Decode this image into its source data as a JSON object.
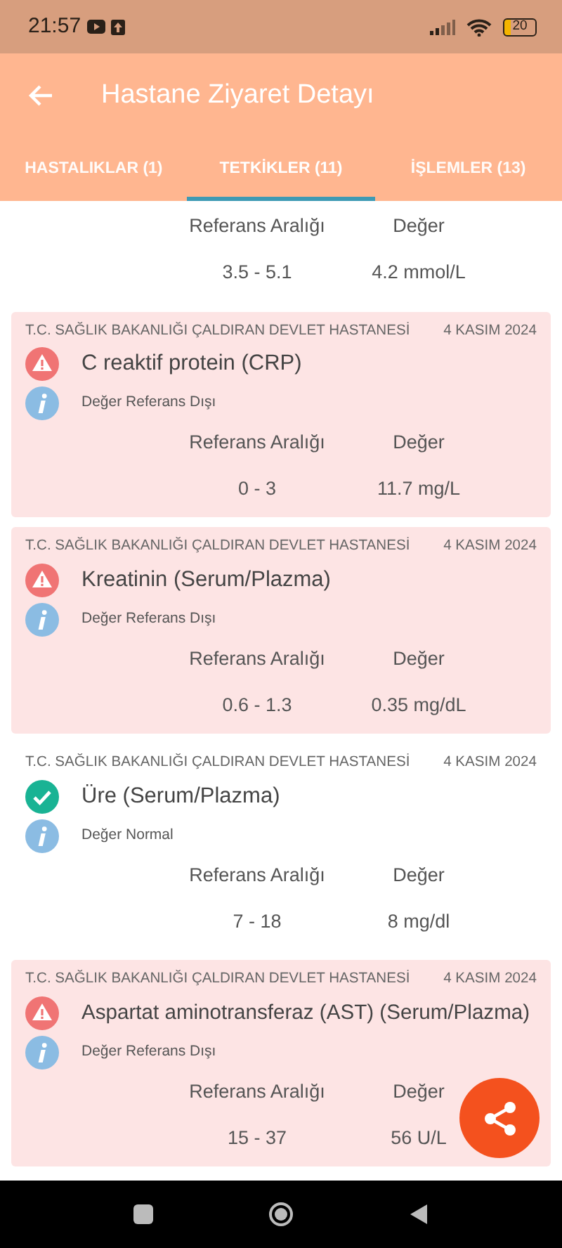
{
  "status_bar": {
    "time": "21:57",
    "battery": "20"
  },
  "app_bar": {
    "title": "Hastane Ziyaret Detayı"
  },
  "tabs": [
    {
      "label": "HASTALIKLAR (1)",
      "selected": false
    },
    {
      "label": "TETKİKLER (11)",
      "selected": true
    },
    {
      "label": "İŞLEMLER (13)",
      "selected": false
    }
  ],
  "tests": [
    {
      "range_label": "Referans Aralığı",
      "value_label": "Değer",
      "range": "3.5 - 5.1",
      "value": "4.2 mmol/L"
    },
    {
      "hospital": "T.C. SAĞLIK BAKANLIĞI ÇALDIRAN DEVLET HASTANESİ",
      "date": "4 KASIM 2024",
      "name": "C reaktif protein (CRP)",
      "kind": "abnormal",
      "note": "Değer Referans Dışı",
      "range_label": "Referans Aralığı",
      "value_label": "Değer",
      "range": "0 - 3",
      "value": "11.7 mg/L"
    },
    {
      "hospital": "T.C. SAĞLIK BAKANLIĞI ÇALDIRAN DEVLET HASTANESİ",
      "date": "4 KASIM 2024",
      "name": "Kreatinin (Serum/Plazma)",
      "kind": "abnormal",
      "note": "Değer Referans Dışı",
      "range_label": "Referans Aralığı",
      "value_label": "Değer",
      "range": "0.6 - 1.3",
      "value": "0.35 mg/dL"
    },
    {
      "hospital": "T.C. SAĞLIK BAKANLIĞI ÇALDIRAN DEVLET HASTANESİ",
      "date": "4 KASIM 2024",
      "name": "Üre (Serum/Plazma)",
      "kind": "normal",
      "note": "Değer Normal",
      "range_label": "Referans Aralığı",
      "value_label": "Değer",
      "range": "7 - 18",
      "value": "8 mg/dl"
    },
    {
      "hospital": "T.C. SAĞLIK BAKANLIĞI ÇALDIRAN DEVLET HASTANESİ",
      "date": "4 KASIM 2024",
      "name": "Aspartat aminotransferaz (AST) (Serum/Plazma)",
      "kind": "abnormal",
      "note": "Değer Referans Dışı",
      "range_label": "Referans Aralığı",
      "value_label": "Değer",
      "range": "15 - 37",
      "value": "56 U/L"
    }
  ]
}
